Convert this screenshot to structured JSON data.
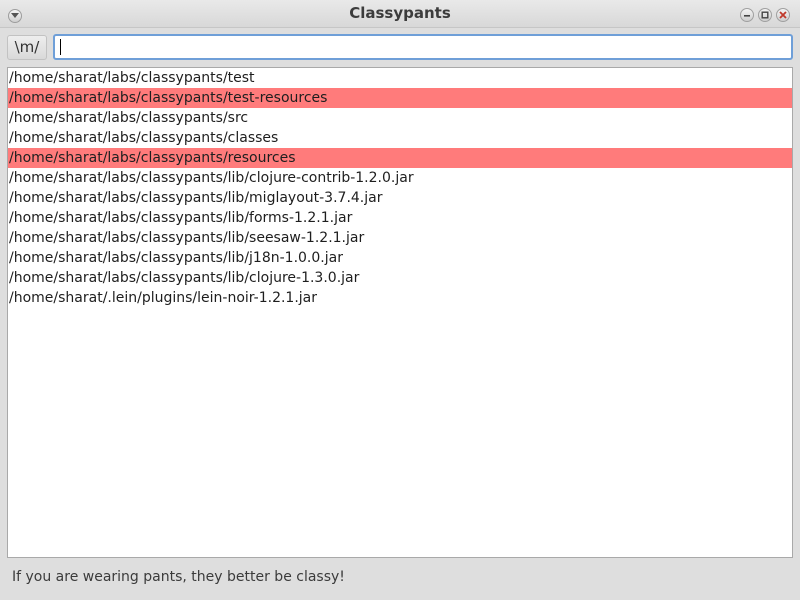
{
  "window": {
    "title": "Classypants"
  },
  "toolbar": {
    "regex_button_label": "\\m/",
    "search_value": ""
  },
  "list": {
    "highlight_color": "#ff7b7b",
    "items": [
      {
        "path": "/home/sharat/labs/classypants/test",
        "highlighted": false
      },
      {
        "path": "/home/sharat/labs/classypants/test-resources",
        "highlighted": true
      },
      {
        "path": "/home/sharat/labs/classypants/src",
        "highlighted": false
      },
      {
        "path": "/home/sharat/labs/classypants/classes",
        "highlighted": false
      },
      {
        "path": "/home/sharat/labs/classypants/resources",
        "highlighted": true
      },
      {
        "path": "/home/sharat/labs/classypants/lib/clojure-contrib-1.2.0.jar",
        "highlighted": false
      },
      {
        "path": "/home/sharat/labs/classypants/lib/miglayout-3.7.4.jar",
        "highlighted": false
      },
      {
        "path": "/home/sharat/labs/classypants/lib/forms-1.2.1.jar",
        "highlighted": false
      },
      {
        "path": "/home/sharat/labs/classypants/lib/seesaw-1.2.1.jar",
        "highlighted": false
      },
      {
        "path": "/home/sharat/labs/classypants/lib/j18n-1.0.0.jar",
        "highlighted": false
      },
      {
        "path": "/home/sharat/labs/classypants/lib/clojure-1.3.0.jar",
        "highlighted": false
      },
      {
        "path": "/home/sharat/.lein/plugins/lein-noir-1.2.1.jar",
        "highlighted": false
      }
    ]
  },
  "status": {
    "text": "If you are wearing pants, they better be classy!"
  },
  "icons": {
    "menu": "chevron-down-icon",
    "minimize": "minimize-icon",
    "maximize": "maximize-icon",
    "close": "close-icon"
  }
}
